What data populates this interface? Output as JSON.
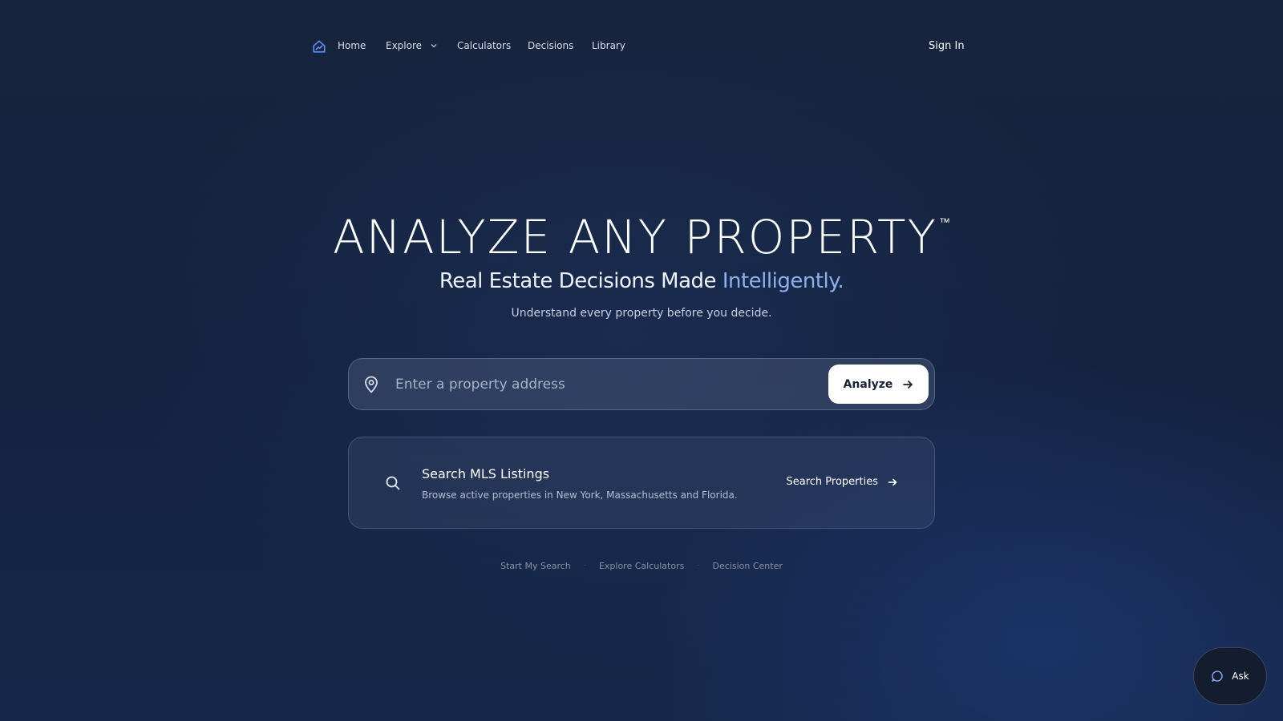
{
  "nav": {
    "logo_icon": "home-chart-icon",
    "items": [
      {
        "label": "Home"
      },
      {
        "label": "Explore",
        "icon": "chevron-down-icon"
      },
      {
        "label": "Calculators"
      },
      {
        "label": "Decisions"
      },
      {
        "label": "Library"
      }
    ],
    "sign_in": "Sign In"
  },
  "hero": {
    "title": "ANALYZE ANY PROPERTY",
    "trademark": "™",
    "subtitle_main": "Real Estate Decisions Made ",
    "subtitle_accent": "Intelligently.",
    "tagline": "Understand every property before you decide."
  },
  "search": {
    "icon": "map-pin-icon",
    "placeholder": "Enter a property address",
    "value": "",
    "button_label": "Analyze",
    "button_icon": "arrow-right-icon"
  },
  "mls": {
    "icon": "search-icon",
    "title": "Search MLS Listings",
    "description": "Browse active properties in New York, Massachusetts and Florida.",
    "link_label": "Search Properties",
    "link_icon": "arrow-right-icon"
  },
  "footer_links": [
    {
      "label": "Start My Search"
    },
    {
      "label": "Explore Calculators"
    },
    {
      "label": "Decision Center"
    }
  ],
  "footer_separator": "·",
  "ask": {
    "label": "Ask",
    "icon": "chat-bubble-icon"
  },
  "colors": {
    "accent": "#8fb0ec",
    "logo": "#5b8def",
    "background": "#17243d"
  }
}
